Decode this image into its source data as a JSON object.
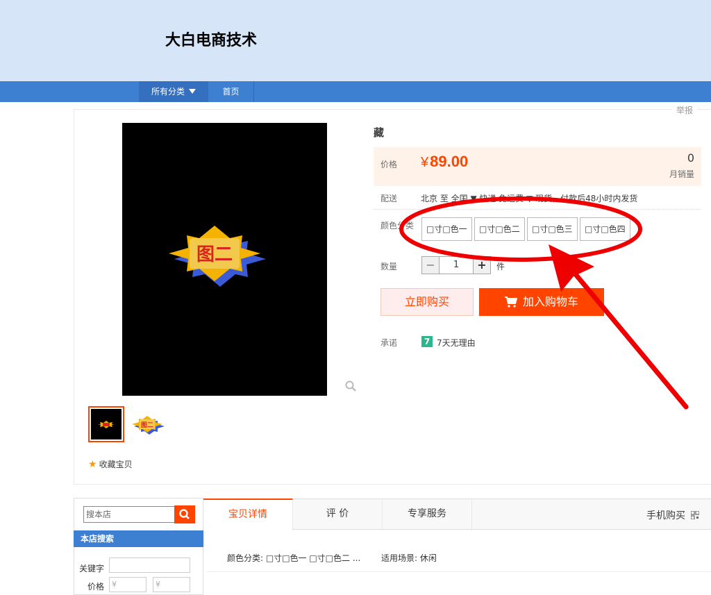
{
  "header": {
    "shop_name": "大白电商技术"
  },
  "nav": {
    "all_categories": "所有分类",
    "home": "首页"
  },
  "report": "举报",
  "product": {
    "title": "藏",
    "thumb_badge_text": "图二",
    "favorite_label": "收藏宝贝",
    "price_label": "价格",
    "currency": "¥",
    "price": "89.00",
    "sales_count": "0",
    "sales_label": "月销量",
    "shipping_label": "配送",
    "shipping_text": "北京 至 全国 ▼ 快递 免运费 ▼ 现货，付款后48小时内发货",
    "color_label": "颜色分类",
    "sku_options": [
      "□寸□色一",
      "□寸□色二",
      "□寸□色三",
      "□寸□色四"
    ],
    "quantity_label": "数量",
    "quantity_value": "1",
    "quantity_minus": "−",
    "quantity_plus": "+",
    "quantity_unit": "件",
    "buy_now_label": "立即购买",
    "add_to_cart_label": "加入购物车",
    "promise_label": "承诺",
    "promise_badge": "7",
    "promise_text": "7天无理由"
  },
  "sidebar": {
    "search_placeholder": "搜本店",
    "store_search_title": "本店搜索",
    "keyword_label": "关键字",
    "price_label": "价格",
    "price_min_placeholder": "¥",
    "price_max_placeholder": "¥"
  },
  "tabs": {
    "details": "宝贝详情",
    "reviews": "评  价",
    "services": "专享服务",
    "mobile_buy": "手机购买"
  },
  "attributes": {
    "color": "颜色分类: □寸□色一 □寸□色二 ...",
    "scene": "适用场景: 休闲"
  },
  "colors": {
    "accent": "#ff4400",
    "nav_blue": "#3d7fd1",
    "header_bg": "#d6e6f8",
    "annotation_red": "#ee0000"
  }
}
